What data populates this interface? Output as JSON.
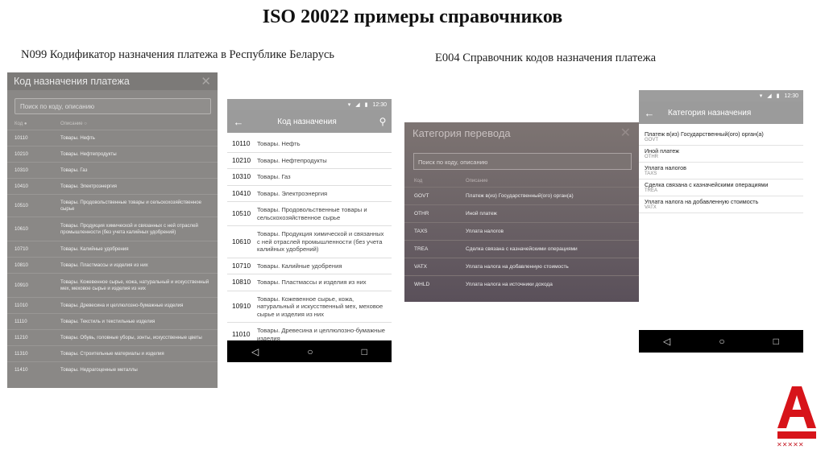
{
  "slide": {
    "title": "ISO 20022 примеры справочников",
    "caption_left": "N099 Кодификатор назначения платежа в Республике Беларусь",
    "caption_right": "E004 Справочник кодов назначения платежа"
  },
  "panel1": {
    "title": "Код назначения платежа",
    "search_placeholder": "Поиск по коду, описанию",
    "col_code": "Код",
    "col_desc": "Описание",
    "rows": [
      {
        "code": "10110",
        "desc": "Товары. Нефть"
      },
      {
        "code": "10210",
        "desc": "Товары. Нефтепродукты"
      },
      {
        "code": "10310",
        "desc": "Товары. Газ"
      },
      {
        "code": "10410",
        "desc": "Товары. Электроэнергия"
      },
      {
        "code": "10510",
        "desc": "Товары. Продовольственные товары и сельскохозяйственное сырье"
      },
      {
        "code": "10610",
        "desc": "Товары. Продукция химической и связанных с ней отраслей промышленности (без учета калийных удобрений)"
      },
      {
        "code": "10710",
        "desc": "Товары. Калийные удобрения"
      },
      {
        "code": "10810",
        "desc": "Товары. Пластмассы и изделия из них"
      },
      {
        "code": "10910",
        "desc": "Товары. Кожевенное сырье, кожа, натуральный и искусственный мех, меховое сырье и изделия из них"
      },
      {
        "code": "11010",
        "desc": "Товары. Древесина и целлюлозно-бумажные изделия"
      },
      {
        "code": "11110",
        "desc": "Товары. Текстиль и текстильные изделия"
      },
      {
        "code": "11210",
        "desc": "Товары. Обувь, головные уборы, зонты, искусственные цветы"
      },
      {
        "code": "11310",
        "desc": "Товары. Строительные материалы и изделия"
      },
      {
        "code": "11410",
        "desc": "Товары. Недрагоценные металлы"
      }
    ]
  },
  "panel2": {
    "time": "12:30",
    "title": "Код назначения",
    "rows": [
      {
        "code": "10110",
        "desc": "Товары. Нефть"
      },
      {
        "code": "10210",
        "desc": "Товары. Нефтепродукты"
      },
      {
        "code": "10310",
        "desc": "Товары. Газ"
      },
      {
        "code": "10410",
        "desc": "Товары. Электроэнергия"
      },
      {
        "code": "10510",
        "desc": "Товары. Продовольственные товары и сельскохозяйственное сырье"
      },
      {
        "code": "10610",
        "desc": "Товары. Продукция химической и связанных с ней отраслей промышленности (без учета калийных удобрений)"
      },
      {
        "code": "10710",
        "desc": "Товары. Калийные удобрения"
      },
      {
        "code": "10810",
        "desc": "Товары. Пластмассы и изделия из них"
      },
      {
        "code": "10910",
        "desc": "Товары. Кожевенное сырье, кожа, натуральный и искусственный мех, меховое сырье и изделия из них"
      },
      {
        "code": "11010",
        "desc": "Товары. Древесина и целлюлозно-бумажные изделия"
      }
    ]
  },
  "panel3": {
    "title": "Категория перевода",
    "search_placeholder": "Поиск по коду, описанию",
    "col_code": "Код",
    "col_desc": "Описание",
    "rows": [
      {
        "code": "GOVT",
        "desc": "Платеж в(из) Государственный(ого) орган(а)"
      },
      {
        "code": "OTHR",
        "desc": "Иной платеж"
      },
      {
        "code": "TAXS",
        "desc": "Уплата налогов"
      },
      {
        "code": "TREA",
        "desc": "Сделка связана с казначейскими операциями"
      },
      {
        "code": "VATX",
        "desc": "Уплата налога на добавленную стоимость"
      },
      {
        "code": "WHLD",
        "desc": "Уплата налога на источники дохода"
      }
    ]
  },
  "panel4": {
    "time": "12:30",
    "title": "Категория назначения",
    "rows": [
      {
        "name": "Платеж в(из) Государственный(ого) орган(а)",
        "code": "GOVT"
      },
      {
        "name": "Иной платеж",
        "code": "OTHR"
      },
      {
        "name": "Уплата налогов",
        "code": "TAXS"
      },
      {
        "name": "Сделка связана с казначейскими операциями",
        "code": "TREA"
      },
      {
        "name": "Уплата налога на добавленную стоимость",
        "code": "VATX"
      }
    ]
  },
  "icons": {
    "back": "arrow-back-icon",
    "search": "search-icon",
    "close": "close-icon",
    "nav_back": "nav-back-icon",
    "nav_home": "nav-home-icon",
    "nav_recent": "nav-recent-icon"
  },
  "colors": {
    "brand": "#d7141a"
  }
}
